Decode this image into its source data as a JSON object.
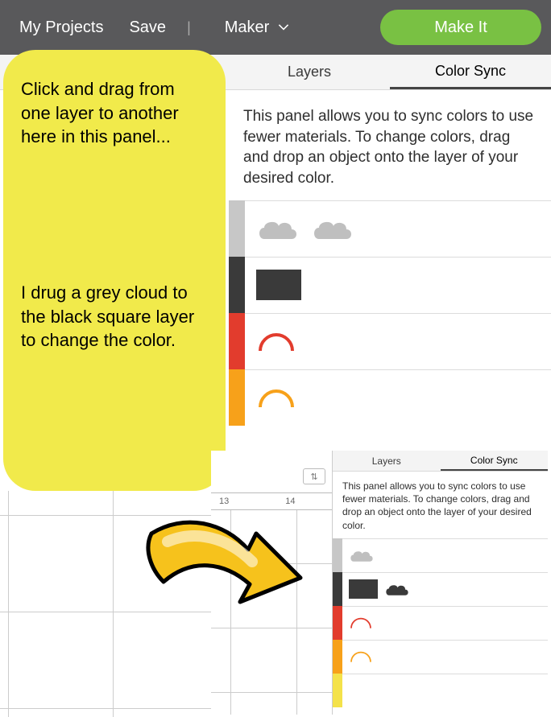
{
  "topbar": {
    "my_projects": "My Projects",
    "save": "Save",
    "divider": "|",
    "maker": "Maker",
    "make_it": "Make It"
  },
  "tabs": {
    "layers": "Layers",
    "color_sync": "Color Sync"
  },
  "panel": {
    "description": "This panel allows you to sync colors to use fewer materials. To change colors, drag and drop an object onto the layer of your desired color."
  },
  "rows": [
    {
      "swatch": "#c7c7c7",
      "shapes": [
        "cloud-grey",
        "cloud-grey"
      ]
    },
    {
      "swatch": "#3a3a3a",
      "shapes": [
        "rect-dark"
      ]
    },
    {
      "swatch": "#e23c2d",
      "shapes": [
        "arc-red"
      ]
    },
    {
      "swatch": "#f7a11a",
      "shapes": [
        "arc-orange"
      ]
    }
  ],
  "note": {
    "p1": "Click and drag from one layer to another here in this panel...",
    "p2": "I drug a grey cloud to the black square layer to change the color."
  },
  "inset": {
    "ruler": [
      "13",
      "14"
    ],
    "zoom_symbol": "⇅",
    "tabs": {
      "layers": "Layers",
      "color_sync": "Color Sync"
    },
    "description": "This panel allows you to sync colors to use fewer materials. To change colors, drag and drop an object onto the layer of your desired color.",
    "rows": [
      {
        "swatch": "#c7c7c7",
        "shapes": [
          "cloud-grey"
        ]
      },
      {
        "swatch": "#3a3a3a",
        "shapes": [
          "rect-dark",
          "cloud-dark"
        ]
      },
      {
        "swatch": "#e23c2d",
        "shapes": [
          "arc-red"
        ]
      },
      {
        "swatch": "#f7a11a",
        "shapes": [
          "arc-orange"
        ]
      },
      {
        "swatch": "#f4e24a",
        "shapes": []
      }
    ]
  },
  "colors": {
    "cloud_grey": "#bfbfbf",
    "cloud_dark": "#3a3a3a",
    "arc_red": "#e23c2d",
    "arc_orange": "#f7a11a"
  }
}
